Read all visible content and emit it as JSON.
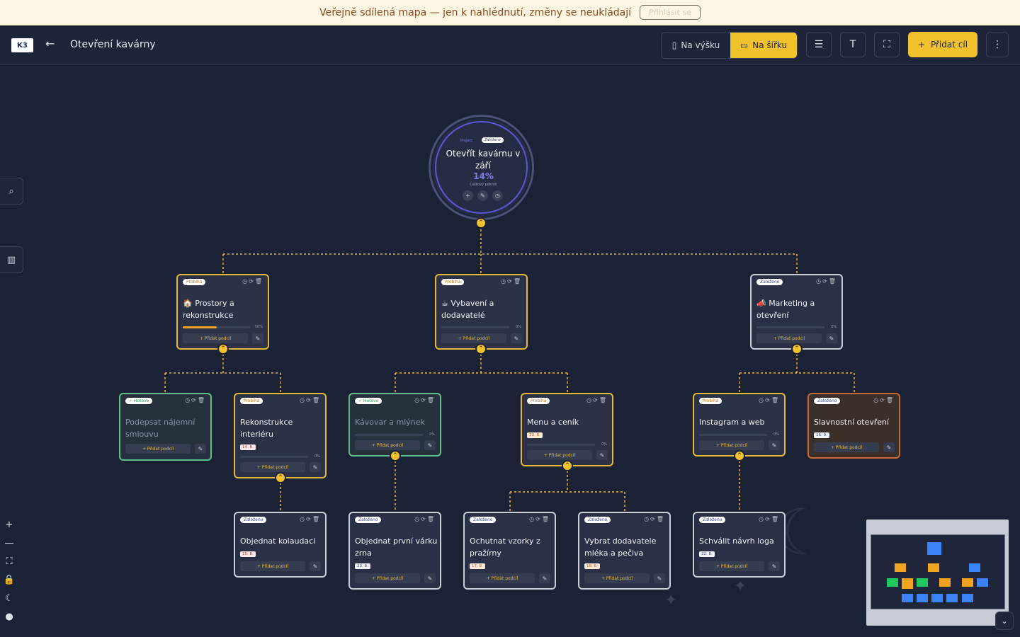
{
  "banner": {
    "text": "Veřejně sdílená mapa — jen k nahlédnutí, změny se neukládají",
    "login": "Přihlásit se"
  },
  "header": {
    "logo": "K3",
    "title": "Otevření kavárny",
    "portrait": "Na výšku",
    "landscape": "Na šířku",
    "add_goal": "Přidat cíl"
  },
  "root": {
    "tag": "Projekt",
    "status": "Založeno",
    "title": "Otevřít kavárnu v září",
    "progress": "14%",
    "progress_label": "Celkový pokrok"
  },
  "add_sub": "+ Přidat podcíl",
  "nodes": {
    "n1": {
      "status": "Probíhá",
      "title": "🏠 Prostory a rekonstrukce",
      "pct": "50%"
    },
    "n2": {
      "status": "Probíhá",
      "title": "☕ Vybavení a dodavatelé",
      "pct": "0%"
    },
    "n3": {
      "status": "Založeno",
      "title": "📣 Marketing a otevření",
      "pct": "0%"
    },
    "n4": {
      "status": "✓ Hotovo",
      "title": "Podepsat nájemní smlouvu"
    },
    "n5": {
      "status": "Probíhá",
      "title": "Rekonstrukce interiéru",
      "date": "14. 8.",
      "pct": "0%"
    },
    "n6": {
      "status": "✓ Hotovo",
      "title": "Kávovar a mlýnek",
      "pct": "0%"
    },
    "n7": {
      "status": "Probíhá",
      "title": "Menu a ceník",
      "date": "20. 8.",
      "pct": "0%"
    },
    "n8": {
      "status": "Probíhá",
      "title": "Instagram a web",
      "pct": "0%"
    },
    "n9": {
      "status": "Založeno",
      "title": "Slavnostní otevření",
      "date": "16. 9."
    },
    "n10": {
      "status": "Založeno",
      "title": "Objednat kolaudaci",
      "date": "15. 8."
    },
    "n11": {
      "status": "Založeno",
      "title": "Objednat první várku zrna",
      "date": "23. 8."
    },
    "n12": {
      "status": "Založeno",
      "title": "Ochutnat vzorky z pražírny",
      "date": "17. 8."
    },
    "n13": {
      "status": "Založeno",
      "title": "Vybrat dodavatele mléka a pečiva",
      "date": "18. 8."
    },
    "n14": {
      "status": "Založeno",
      "title": "Schválit návrh loga",
      "date": "22. 8."
    }
  },
  "progress": {
    "n1": 0.5
  },
  "colors": {
    "accent": "#f2c12e",
    "done": "#5cc08a",
    "new": "#c9ced8",
    "root": "#5c57d6",
    "bg": "#1b2236"
  }
}
